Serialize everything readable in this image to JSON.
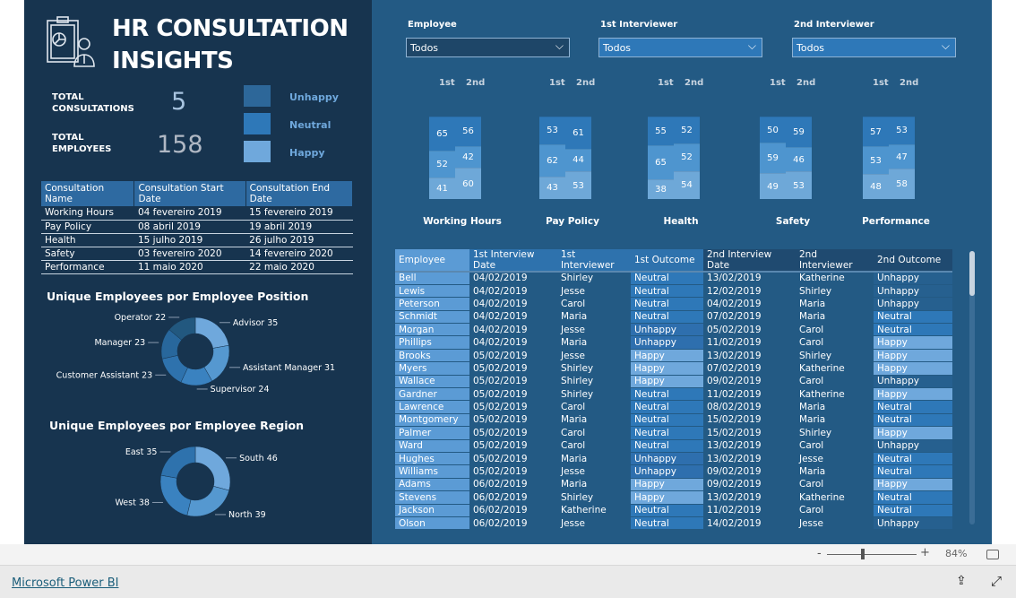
{
  "title": "HR CONSULTATION INSIGHTS",
  "kpi": {
    "consultations_label": "TOTAL CONSULTATIONS",
    "consultations_value": "5",
    "employees_label": "TOTAL EMPLOYEES",
    "employees_value": "158"
  },
  "legend": [
    {
      "label": "Unhappy",
      "color": "#2d6799"
    },
    {
      "label": "Neutral",
      "color": "#2e78b8"
    },
    {
      "label": "Happy",
      "color": "#6fa8dc"
    }
  ],
  "consult_table": {
    "headers": [
      "Consultation Name",
      "Consultation Start Date",
      "Consultation End Date"
    ],
    "rows": [
      [
        "Working Hours",
        "04 fevereiro 2019",
        "15 fevereiro 2019"
      ],
      [
        "Pay Policy",
        "08 abril 2019",
        "19 abril 2019"
      ],
      [
        "Health",
        "15 julho 2019",
        "26 julho 2019"
      ],
      [
        "Safety",
        "03 fevereiro 2020",
        "14 fevereiro 2020"
      ],
      [
        "Performance",
        "11 maio 2020",
        "22 maio 2020"
      ]
    ]
  },
  "chart_data": [
    {
      "type": "pie",
      "donut": true,
      "title": "Unique Employees por Employee Position",
      "categories": [
        "Advisor",
        "Assistant Manager",
        "Supervisor",
        "Customer Assistant",
        "Manager",
        "Operator"
      ],
      "values": [
        35,
        31,
        24,
        23,
        23,
        22
      ],
      "colors": [
        "#6fa8dc",
        "#5598d0",
        "#3a82c0",
        "#2e72ad",
        "#28679c",
        "#22587f"
      ]
    },
    {
      "type": "pie",
      "donut": true,
      "title": "Unique Employees por Employee Region",
      "categories": [
        "South",
        "North",
        "West",
        "East"
      ],
      "values": [
        46,
        39,
        38,
        35
      ],
      "colors": [
        "#6fa8dc",
        "#5598d0",
        "#3a82c0",
        "#2e72ad"
      ]
    },
    {
      "type": "bar",
      "stacked": true,
      "categories": [
        "Working Hours",
        "Pay Policy",
        "Health",
        "Safety",
        "Performance"
      ],
      "column_labels": [
        "1st",
        "2nd"
      ],
      "series": [
        {
          "name": "Unhappy",
          "first": [
            65,
            53,
            55,
            50,
            57
          ],
          "second": [
            56,
            61,
            52,
            59,
            53
          ]
        },
        {
          "name": "Neutral",
          "first": [
            52,
            62,
            65,
            59,
            53
          ],
          "second": [
            42,
            44,
            52,
            46,
            47
          ]
        },
        {
          "name": "Happy",
          "first": [
            41,
            43,
            38,
            49,
            48
          ],
          "second": [
            60,
            53,
            54,
            53,
            58
          ]
        }
      ]
    }
  ],
  "filters": [
    {
      "label": "Employee",
      "value": "Todos"
    },
    {
      "label": "1st Interviewer",
      "value": "Todos"
    },
    {
      "label": "2nd Interviewer",
      "value": "Todos"
    }
  ],
  "emp_table": {
    "headers": [
      "Employee",
      "1st Interview Date",
      "1st Interviewer",
      "1st Outcome",
      "2nd Interview Date",
      "2nd Interviewer",
      "2nd Outcome"
    ],
    "rows": [
      [
        "Bell",
        "04/02/2019",
        "Shirley",
        "Neutral",
        "13/02/2019",
        "Katherine",
        "Unhappy"
      ],
      [
        "Lewis",
        "04/02/2019",
        "Jesse",
        "Neutral",
        "12/02/2019",
        "Shirley",
        "Unhappy"
      ],
      [
        "Peterson",
        "04/02/2019",
        "Carol",
        "Neutral",
        "04/02/2019",
        "Maria",
        "Unhappy"
      ],
      [
        "Schmidt",
        "04/02/2019",
        "Maria",
        "Neutral",
        "07/02/2019",
        "Maria",
        "Neutral"
      ],
      [
        "Morgan",
        "04/02/2019",
        "Jesse",
        "Unhappy",
        "05/02/2019",
        "Carol",
        "Neutral"
      ],
      [
        "Phillips",
        "04/02/2019",
        "Maria",
        "Unhappy",
        "11/02/2019",
        "Carol",
        "Happy"
      ],
      [
        "Brooks",
        "05/02/2019",
        "Jesse",
        "Happy",
        "13/02/2019",
        "Shirley",
        "Happy"
      ],
      [
        "Myers",
        "05/02/2019",
        "Shirley",
        "Happy",
        "07/02/2019",
        "Katherine",
        "Happy"
      ],
      [
        "Wallace",
        "05/02/2019",
        "Shirley",
        "Happy",
        "09/02/2019",
        "Carol",
        "Unhappy"
      ],
      [
        "Gardner",
        "05/02/2019",
        "Shirley",
        "Neutral",
        "11/02/2019",
        "Katherine",
        "Happy"
      ],
      [
        "Lawrence",
        "05/02/2019",
        "Carol",
        "Neutral",
        "08/02/2019",
        "Maria",
        "Neutral"
      ],
      [
        "Montgomery",
        "05/02/2019",
        "Maria",
        "Neutral",
        "15/02/2019",
        "Maria",
        "Neutral"
      ],
      [
        "Palmer",
        "05/02/2019",
        "Carol",
        "Neutral",
        "15/02/2019",
        "Shirley",
        "Happy"
      ],
      [
        "Ward",
        "05/02/2019",
        "Carol",
        "Neutral",
        "13/02/2019",
        "Carol",
        "Unhappy"
      ],
      [
        "Hughes",
        "05/02/2019",
        "Maria",
        "Unhappy",
        "13/02/2019",
        "Jesse",
        "Neutral"
      ],
      [
        "Williams",
        "05/02/2019",
        "Jesse",
        "Unhappy",
        "09/02/2019",
        "Maria",
        "Neutral"
      ],
      [
        "Adams",
        "06/02/2019",
        "Maria",
        "Happy",
        "09/02/2019",
        "Carol",
        "Happy"
      ],
      [
        "Stevens",
        "06/02/2019",
        "Shirley",
        "Happy",
        "13/02/2019",
        "Katherine",
        "Neutral"
      ],
      [
        "Jackson",
        "06/02/2019",
        "Katherine",
        "Neutral",
        "11/02/2019",
        "Carol",
        "Neutral"
      ],
      [
        "Olson",
        "06/02/2019",
        "Jesse",
        "Neutral",
        "14/02/2019",
        "Jesse",
        "Unhappy"
      ]
    ]
  },
  "footer": {
    "zoom": "84%",
    "minus": "-",
    "plus": "+",
    "brand_link": "Microsoft Power BI"
  }
}
